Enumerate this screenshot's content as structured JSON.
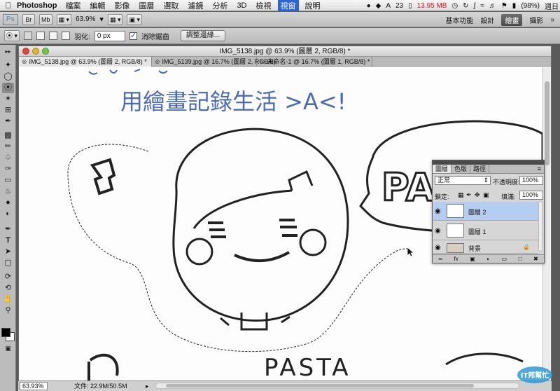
{
  "menubar": {
    "apple_icon": "apple-logo",
    "app_name": "Photoshop",
    "items": [
      "檔案",
      "編輯",
      "影像",
      "圖層",
      "選取",
      "濾鏡",
      "分析",
      "3D",
      "檢視",
      "視窗",
      "說明"
    ],
    "active_item": "視窗",
    "status": {
      "adobe_count": "23",
      "memory": "13.95 MB",
      "battery": "(98%)",
      "clock": "週日"
    }
  },
  "appbar": {
    "logo": "Ps",
    "br_label": "Br",
    "mb_label": "Mb",
    "zoom": "63.9%",
    "workspaces": [
      "基本功能",
      "設計",
      "繪畫",
      "攝影"
    ],
    "active_workspace": "繪畫"
  },
  "options": {
    "feather_label": "羽化:",
    "feather_value": "0 px",
    "antialias_label": "消除鋸齒",
    "antialias_checked": true,
    "refine_button": "調整邊緣..."
  },
  "document": {
    "title": "IMG_5138.jpg @ 63.9% (圖層 2, RGB/8) *",
    "tabs": [
      {
        "label": "IMG_5138.jpg @ 63.9% (圖層 2, RGB/8) *",
        "active": true
      },
      {
        "label": "IMG_5139.jpg @ 16.7% (圖層 2, RGB/8)",
        "active": false
      },
      {
        "label": "未命名-1 @ 16.7% (圖層 1, RGB/8) *",
        "active": false
      }
    ],
    "canvas_text": {
      "handwritten_title": "用繪畫記錄生活 >A<!",
      "speech_word": "PA",
      "bottom_word": "PASTA"
    }
  },
  "statusbar": {
    "zoom": "63.93%",
    "doc_size": "文件: 22.9M/50.5M"
  },
  "layers_panel": {
    "tabs": [
      "圖層",
      "色版",
      "路徑"
    ],
    "active_tab": "圖層",
    "blend_mode": "正常",
    "opacity_label": "不透明度:",
    "opacity_value": "100%",
    "lock_label": "鎖定:",
    "fill_label": "填滿:",
    "fill_value": "100%",
    "layers": [
      {
        "name": "圖層 2",
        "selected": true
      },
      {
        "name": "圖層 1",
        "selected": false
      },
      {
        "name": "背景",
        "selected": false,
        "locked": true
      }
    ]
  },
  "watermark": {
    "text": "IT邦幫忙"
  }
}
